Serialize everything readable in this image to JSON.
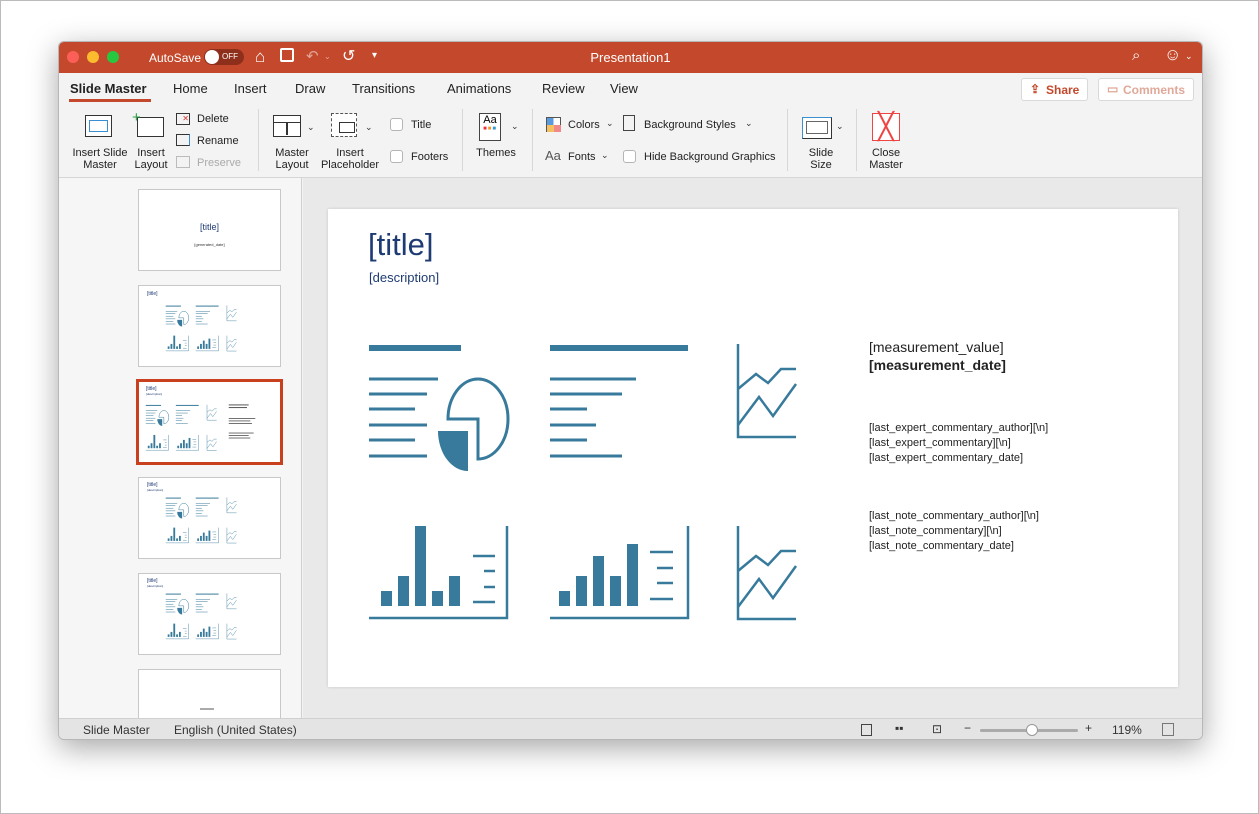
{
  "window": {
    "title": "Presentation1",
    "autosave_label": "AutoSave",
    "autosave_state": "OFF",
    "accent": "#c4492c"
  },
  "tabs": [
    "Slide Master",
    "Home",
    "Insert",
    "Draw",
    "Transitions",
    "Animations",
    "Review",
    "View"
  ],
  "active_tab": "Slide Master",
  "share_label": "Share",
  "comments_label": "Comments",
  "ribbon": {
    "insert_slide_master": "Insert Slide Master",
    "insert_layout": "Insert Layout",
    "delete": "Delete",
    "rename": "Rename",
    "preserve": "Preserve",
    "master_layout": "Master Layout",
    "insert_placeholder": "Insert Placeholder",
    "title": "Title",
    "footers": "Footers",
    "themes": "Themes",
    "colors": "Colors",
    "fonts": "Fonts",
    "background_styles": "Background Styles",
    "hide_background_graphics": "Hide Background Graphics",
    "slide_size": "Slide Size",
    "close_master": "Close Master"
  },
  "thumbnails": [
    {
      "title": "[title]",
      "subtitle": "[generated_date]"
    },
    {
      "title": "[title]"
    },
    {
      "title": "[title]",
      "subtitle": "[description]",
      "selected": true
    },
    {
      "title": "[title]",
      "subtitle": "[description]"
    },
    {
      "title": "[title]",
      "subtitle": "[description]"
    },
    {
      "title": ""
    }
  ],
  "slide": {
    "title": "[title]",
    "description": "[description]",
    "measurement_value": "[measurement_value]",
    "measurement_date": "[measurement_date]",
    "expert": [
      "[last_expert_commentary_author][\\n]",
      "[last_expert_commentary][\\n]",
      "[last_expert_commentary_date]"
    ],
    "note": [
      "[last_note_commentary_author][\\n]",
      "[last_note_commentary][\\n]",
      "[last_note_commentary_date]"
    ],
    "graphic_color": "#377a9b",
    "title_color": "#1e3b73"
  },
  "status": {
    "view": "Slide Master",
    "language": "English (United States)",
    "zoom": "119%",
    "zoom_level_percent": 119
  }
}
